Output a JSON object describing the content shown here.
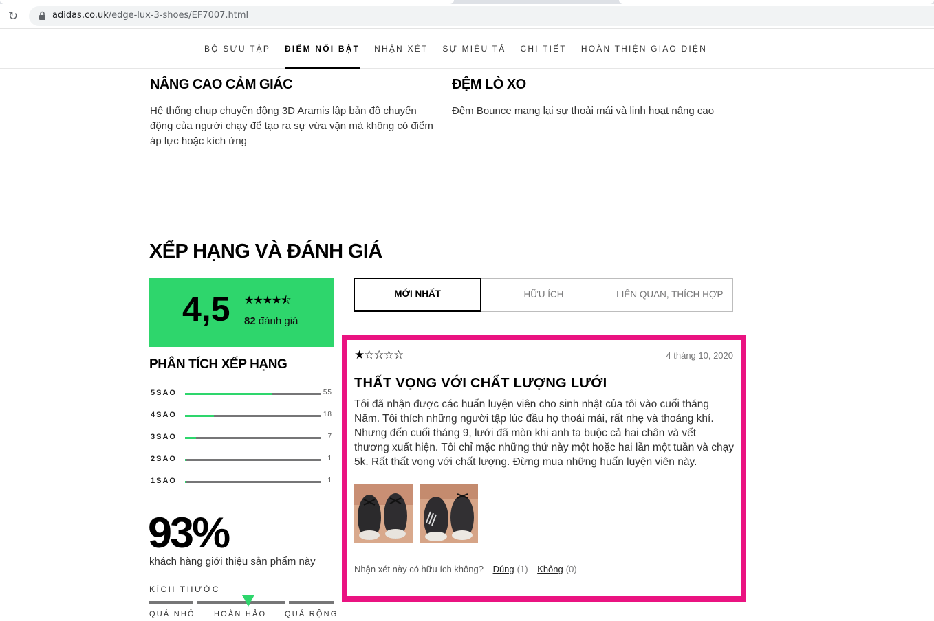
{
  "browser": {
    "domain": "adidas.co.uk",
    "path": "/edge-lux-3-shoes/EF7007.html"
  },
  "nav": {
    "tabs": [
      {
        "label": "BỘ SƯU TẬP"
      },
      {
        "label": "ĐIỂM NỔI BẬT",
        "active": true
      },
      {
        "label": "NHẬN XÉT"
      },
      {
        "label": "SỰ MIÊU TẢ"
      },
      {
        "label": "CHI TIẾT"
      },
      {
        "label": "HOÀN THIỆN GIAO DIỆN"
      }
    ]
  },
  "features": [
    {
      "title": "NÂNG CAO CẢM GIÁC",
      "text": "Hệ thống chụp chuyển động 3D Aramis lập bản đồ chuyển động của người chạy để tạo ra sự vừa vặn mà không có điểm áp lực hoặc kích ứng"
    },
    {
      "title": "ĐỆM LÒ XO",
      "text": "Đệm Bounce mang lại sự thoải mái và linh hoạt nâng cao"
    }
  ],
  "ratings": {
    "section_title": "XẾP HẠNG VÀ ĐÁNH GIÁ",
    "average": "4,5",
    "average_value": 4.5,
    "stars_display": "★★★★⯪",
    "review_count": "82",
    "review_count_label": "đánh giá",
    "breakdown_title": "PHÂN TÍCH XẾP HẠNG",
    "breakdown": [
      {
        "label": "5SAO",
        "count": "55",
        "fraction": 0.64
      },
      {
        "label": "4SAO",
        "count": "18",
        "fraction": 0.21
      },
      {
        "label": "3SAO",
        "count": "7",
        "fraction": 0.08
      },
      {
        "label": "2SAO",
        "count": "1",
        "fraction": 0.012
      },
      {
        "label": "1SAO",
        "count": "1",
        "fraction": 0.012
      }
    ],
    "recommend_pct": "93%",
    "recommend_label": "khách hàng giới thiệu sản phẩm này",
    "size": {
      "title": "KÍCH THƯỚC",
      "labels": [
        "QUÁ NHỎ",
        "HOÀN HẢO",
        "QUÁ RỘNG"
      ],
      "value_fraction": 0.54
    }
  },
  "sort_tabs": [
    {
      "label": "MỚI NHẤT",
      "active": true
    },
    {
      "label": "HỮU ÍCH"
    },
    {
      "label": "LIÊN QUAN, THÍCH HỢP"
    }
  ],
  "review": {
    "stars": "★☆☆☆☆",
    "rating": 1,
    "date": "4 tháng 10, 2020",
    "title": "THẤT VỌNG VỚI CHẤT LƯỢNG LƯỚI",
    "body": "Tôi đã nhận được các huấn luyện viên cho sinh nhật của tôi vào cuối tháng Năm. Tôi thích những người tập lúc đầu họ thoải mái, rất nhẹ và thoáng khí. Nhưng đến cuối tháng 9, lưới đã mòn khi anh ta buộc cả hai chân và vết thương xuất hiện. Tôi chỉ mặc những thứ này một hoặc hai lần một tuần và chạy 5k. Rất thất vọng với chất lượng. Đừng mua những huấn luyện viên này.",
    "helpful_question": "Nhận xét này có hữu ích không?",
    "yes_label": "Đúng",
    "yes_count": "(1)",
    "no_label": "Không",
    "no_count": "(0)"
  },
  "colors": {
    "accent_green": "#2ed66c",
    "highlight_pink": "#ea1381"
  }
}
